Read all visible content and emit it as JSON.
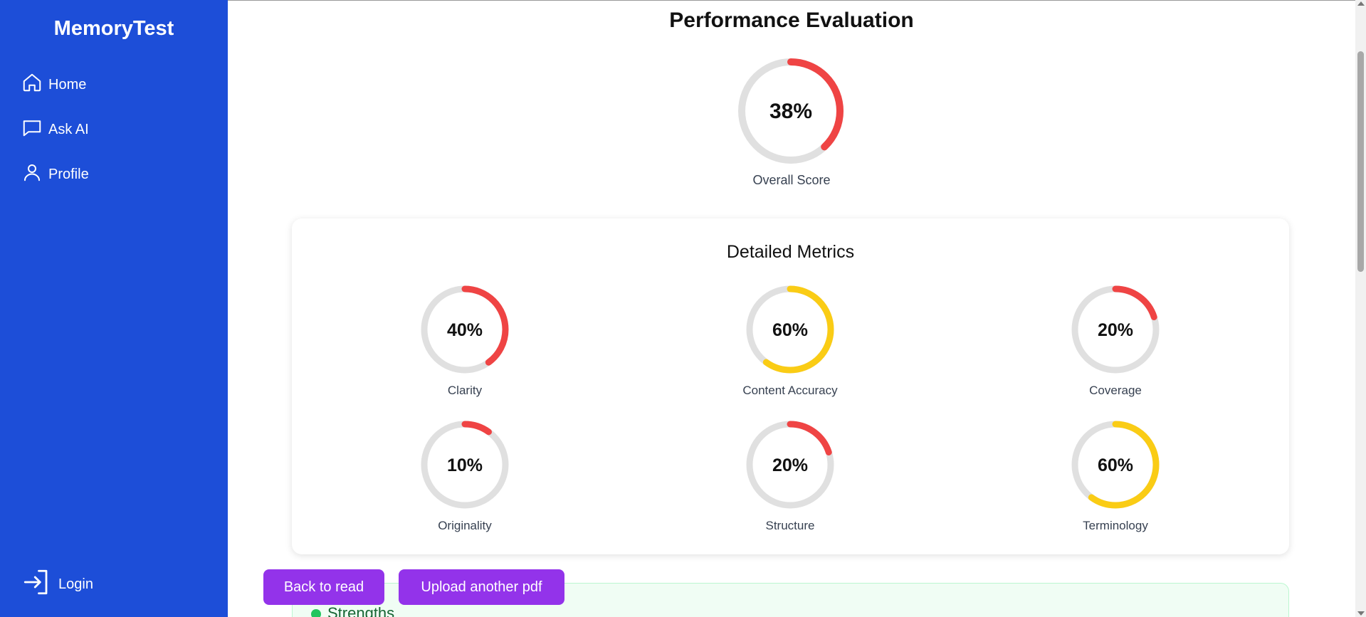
{
  "app": {
    "title": "MemoryTest"
  },
  "sidebar": {
    "items": [
      {
        "label": "Home",
        "icon": "home-icon"
      },
      {
        "label": "Ask AI",
        "icon": "chat-icon"
      },
      {
        "label": "Profile",
        "icon": "user-icon"
      }
    ],
    "login": {
      "label": "Login",
      "icon": "login-icon"
    }
  },
  "main": {
    "title": "Performance Evaluation",
    "overall": {
      "value": 38,
      "text": "38%",
      "label": "Overall Score",
      "color": "#ef4444"
    },
    "details_title": "Detailed Metrics",
    "metrics": [
      {
        "label": "Clarity",
        "value": 40,
        "text": "40%",
        "color": "#ef4444"
      },
      {
        "label": "Content Accuracy",
        "value": 60,
        "text": "60%",
        "color": "#facc15"
      },
      {
        "label": "Coverage",
        "value": 20,
        "text": "20%",
        "color": "#ef4444"
      },
      {
        "label": "Originality",
        "value": 10,
        "text": "10%",
        "color": "#ef4444"
      },
      {
        "label": "Structure",
        "value": 20,
        "text": "20%",
        "color": "#ef4444"
      },
      {
        "label": "Terminology",
        "value": 60,
        "text": "60%",
        "color": "#facc15"
      }
    ],
    "buttons": {
      "back": "Back to read",
      "upload": "Upload another pdf"
    },
    "strengths_title": "Strengths"
  },
  "colors": {
    "sidebar": "#1d4ed8",
    "button": "#9333ea",
    "track": "#e0e0e0"
  }
}
